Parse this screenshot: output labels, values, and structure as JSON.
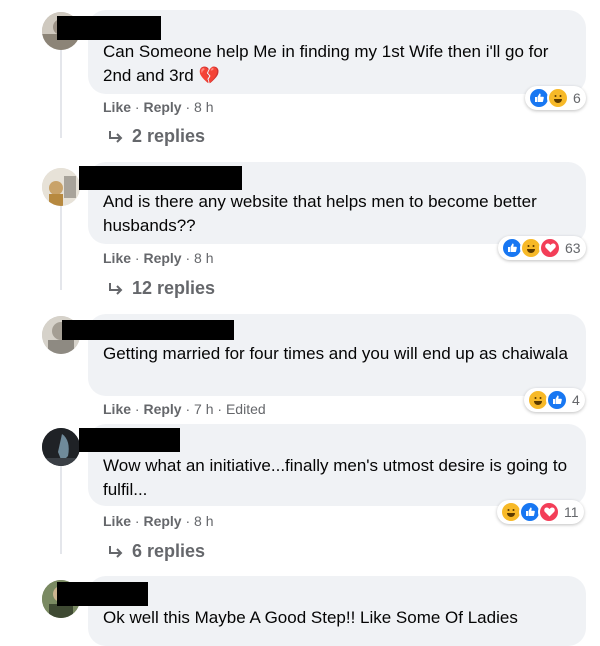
{
  "comments": [
    {
      "text": "Can Someone help Me in finding my 1st Wife then i'll go for 2nd and 3rd",
      "emoji": "💔",
      "like": "Like",
      "reply": "Reply",
      "time": "8 h",
      "edited": "",
      "reaction_count": "6",
      "replies": "2 replies"
    },
    {
      "text": "And is there any website that helps men to become better husbands??",
      "like": "Like",
      "reply": "Reply",
      "time": "8 h",
      "edited": "",
      "reaction_count": "63",
      "replies": "12 replies"
    },
    {
      "text": "Getting married for four times and you will end up as chaiwala",
      "like": "Like",
      "reply": "Reply",
      "time": "7 h",
      "edited": "Edited",
      "reaction_count": "4",
      "replies": ""
    },
    {
      "text": "Wow what an initiative...finally men's utmost desire is going to fulfil...",
      "like": "Like",
      "reply": "Reply",
      "time": "8 h",
      "edited": "",
      "reaction_count": "11",
      "replies": "6 replies"
    },
    {
      "text": "Ok well this Maybe A Good Step!! Like Some Of Ladies"
    }
  ],
  "separator": "·",
  "colors": {
    "like": "#1877f2",
    "haha": "#f7b928",
    "love": "#f33e58",
    "bubble": "#f0f2f5",
    "meta": "#65676b"
  }
}
